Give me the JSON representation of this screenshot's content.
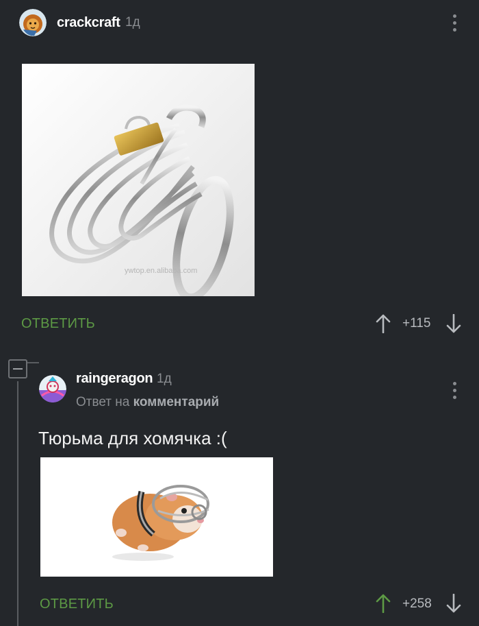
{
  "comments": [
    {
      "user": "crackcraft",
      "time": "1д",
      "image_watermark": "ywtop.en.alibaba.com",
      "reply_label": "ОТВЕТИТЬ",
      "rating": "+115"
    },
    {
      "user": "raingeragon",
      "time": "1д",
      "reply_to_prefix": "Ответ на",
      "reply_to_link": "комментарий",
      "text": "Тюрьма для хомячка :(",
      "reply_label": "ОТВЕТИТЬ",
      "rating": "+258"
    }
  ],
  "colors": {
    "background": "#24272b",
    "reply_green": "#5d9a45",
    "upvoted_green": "#5d9a45",
    "muted": "#8a8d91"
  },
  "icons": [
    "avatar-lion",
    "avatar-aztec",
    "kebab-menu-icon",
    "arrow-up-icon",
    "arrow-down-icon",
    "collapse-minus-icon"
  ]
}
